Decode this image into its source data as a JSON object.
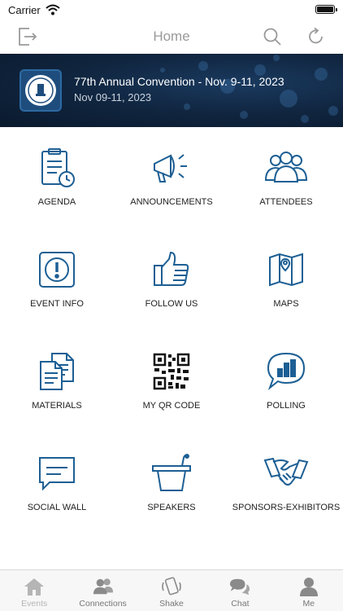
{
  "status_bar": {
    "carrier": "Carrier"
  },
  "nav": {
    "title": "Home"
  },
  "banner": {
    "title": "77th Annual Convention - Nov. 9-11, 2023",
    "date": "Nov 09-11, 2023",
    "logo_text": "OREGON SCHOOL BOARDS ASSOCIATION"
  },
  "tiles": [
    {
      "label": "AGENDA",
      "icon": "clipboard-clock-icon"
    },
    {
      "label": "ANNOUNCEMENTS",
      "icon": "megaphone-icon"
    },
    {
      "label": "ATTENDEES",
      "icon": "people-icon"
    },
    {
      "label": "EVENT INFO",
      "icon": "info-exclamation-icon"
    },
    {
      "label": "FOLLOW US",
      "icon": "thumbs-up-icon"
    },
    {
      "label": "MAPS",
      "icon": "map-pin-icon"
    },
    {
      "label": "MATERIALS",
      "icon": "documents-icon"
    },
    {
      "label": "MY QR CODE",
      "icon": "qr-code-icon"
    },
    {
      "label": "POLLING",
      "icon": "poll-chat-icon"
    },
    {
      "label": "SOCIAL WALL",
      "icon": "chat-board-icon"
    },
    {
      "label": "SPEAKERS",
      "icon": "podium-icon"
    },
    {
      "label": "SPONSORS-EXHIBITORS",
      "icon": "handshake-icon"
    }
  ],
  "tab_bar": [
    {
      "label": "Events",
      "icon": "home-icon"
    },
    {
      "label": "Connections",
      "icon": "connections-icon"
    },
    {
      "label": "Shake",
      "icon": "shake-phone-icon"
    },
    {
      "label": "Chat",
      "icon": "chat-bubbles-icon"
    },
    {
      "label": "Me",
      "icon": "person-icon"
    }
  ],
  "colors": {
    "icon_blue": "#1d5f94",
    "banner_dark": "#0f2540",
    "tab_gray": "#8a8a8a"
  }
}
